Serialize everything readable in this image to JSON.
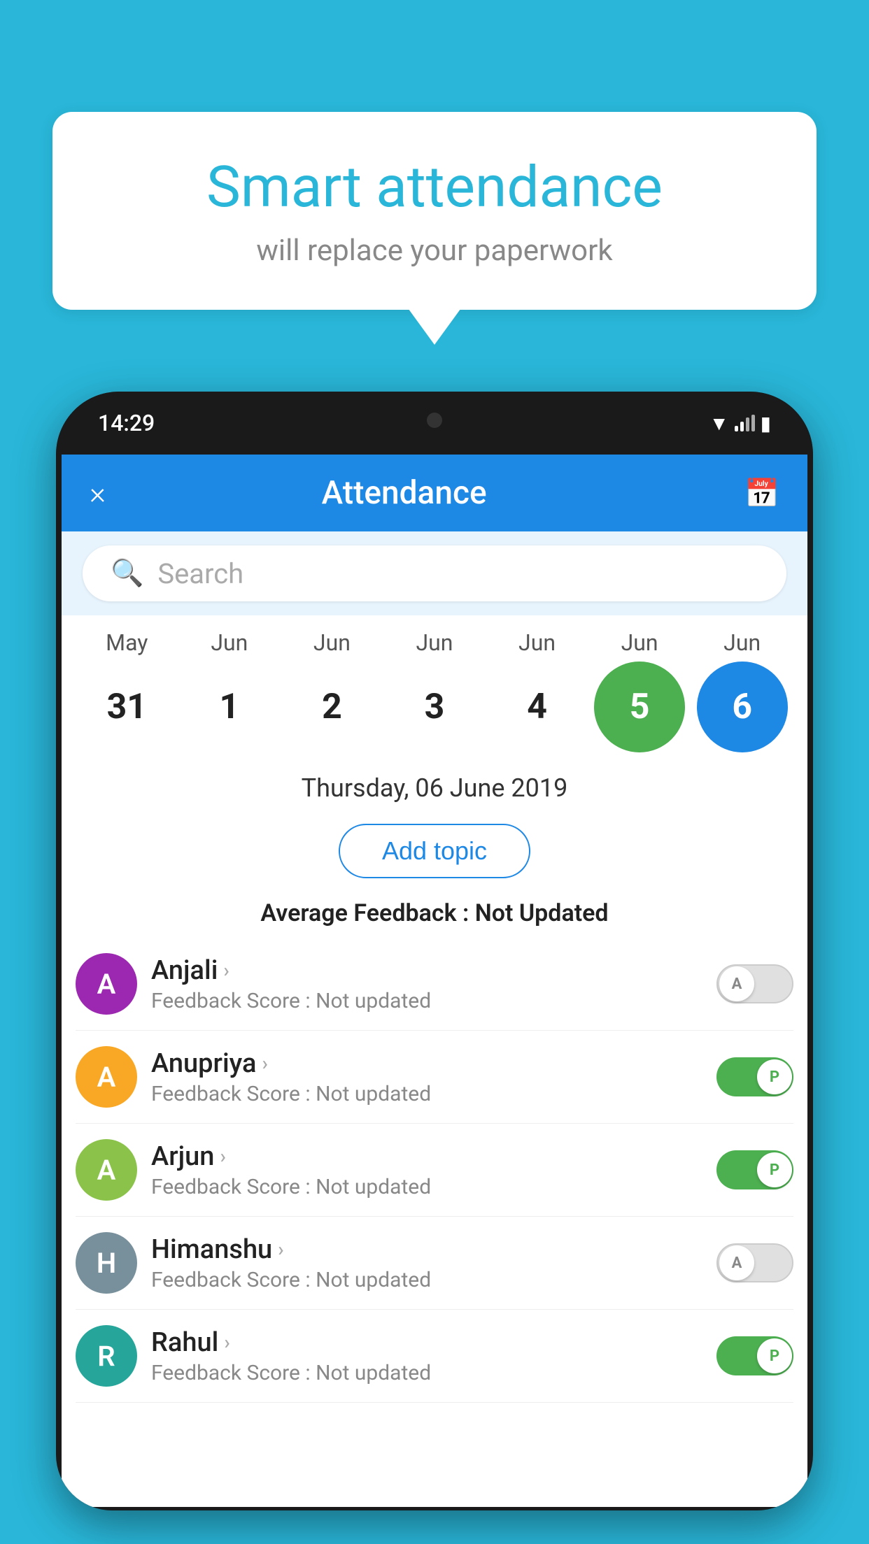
{
  "background_color": "#29b6d8",
  "bubble": {
    "title": "Smart attendance",
    "subtitle": "will replace your paperwork"
  },
  "phone": {
    "time": "14:29",
    "app_bar": {
      "title": "Attendance",
      "close_label": "×",
      "calendar_icon": "📅"
    },
    "search": {
      "placeholder": "Search"
    },
    "calendar": {
      "months": [
        "May",
        "Jun",
        "Jun",
        "Jun",
        "Jun",
        "Jun",
        "Jun"
      ],
      "dates": [
        "31",
        "1",
        "2",
        "3",
        "4",
        "5",
        "6"
      ],
      "today_index": 5,
      "selected_index": 6
    },
    "selected_date_label": "Thursday, 06 June 2019",
    "add_topic_label": "Add topic",
    "avg_feedback_label": "Average Feedback :",
    "avg_feedback_value": "Not Updated",
    "students": [
      {
        "name": "Anjali",
        "avatar_letter": "A",
        "avatar_color": "#9c27b0",
        "feedback": "Feedback Score : Not updated",
        "attendance": "absent",
        "toggle_letter": "A"
      },
      {
        "name": "Anupriya",
        "avatar_letter": "A",
        "avatar_color": "#f9a825",
        "feedback": "Feedback Score : Not updated",
        "attendance": "present",
        "toggle_letter": "P"
      },
      {
        "name": "Arjun",
        "avatar_letter": "A",
        "avatar_color": "#8bc34a",
        "feedback": "Feedback Score : Not updated",
        "attendance": "present",
        "toggle_letter": "P"
      },
      {
        "name": "Himanshu",
        "avatar_letter": "H",
        "avatar_color": "#78909c",
        "feedback": "Feedback Score : Not updated",
        "attendance": "absent",
        "toggle_letter": "A"
      },
      {
        "name": "Rahul",
        "avatar_letter": "R",
        "avatar_color": "#26a69a",
        "feedback": "Feedback Score : Not updated",
        "attendance": "present",
        "toggle_letter": "P"
      }
    ]
  }
}
